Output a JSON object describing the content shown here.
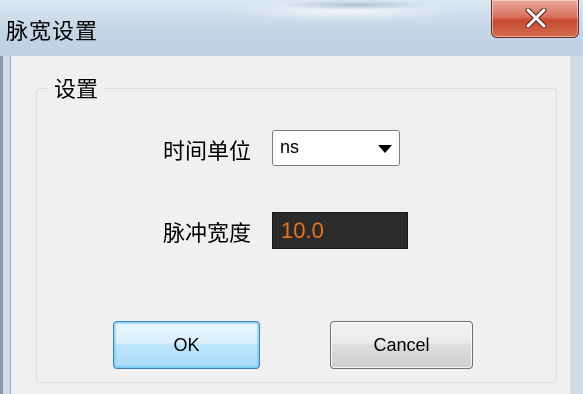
{
  "window": {
    "title": "脉宽设置"
  },
  "group": {
    "legend": "设置"
  },
  "time_unit": {
    "label": "时间单位",
    "selected": "ns"
  },
  "pulse_width": {
    "label": "脉冲宽度",
    "value": "10.0",
    "value_color": "#e8731c",
    "background_color": "#2b2b2b"
  },
  "buttons": {
    "ok_label": "OK",
    "cancel_label": "Cancel"
  },
  "icons": {
    "close": "close-icon",
    "dropdown": "dropdown-arrow-icon"
  }
}
